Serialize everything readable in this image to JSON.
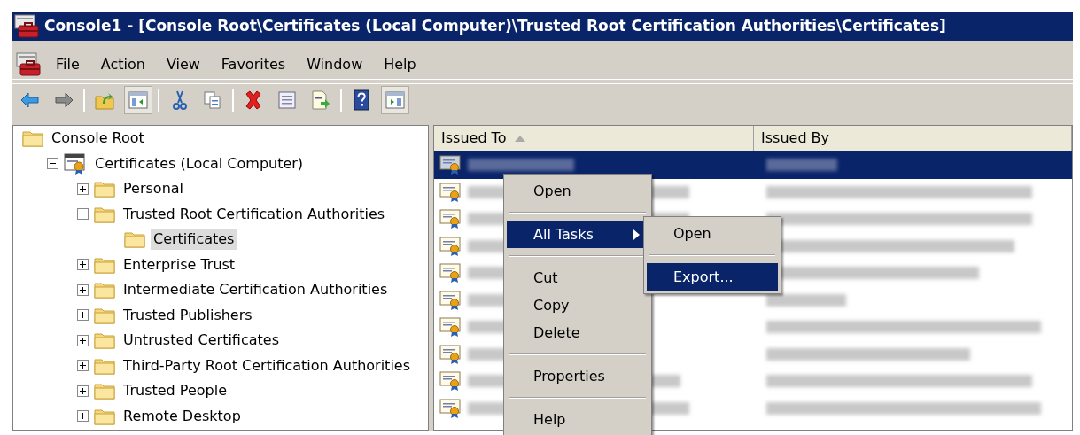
{
  "window": {
    "title": "Console1 - [Console Root\\Certificates (Local Computer)\\Trusted Root Certification Authorities\\Certificates]"
  },
  "menu_bar": [
    "File",
    "Action",
    "View",
    "Favorites",
    "Window",
    "Help"
  ],
  "toolbar": [
    {
      "kind": "back",
      "pressed": false
    },
    {
      "kind": "forward",
      "pressed": false
    },
    {
      "kind": "separator"
    },
    {
      "kind": "up",
      "pressed": false
    },
    {
      "kind": "tree",
      "pressed": true
    },
    {
      "kind": "separator"
    },
    {
      "kind": "cut",
      "pressed": false
    },
    {
      "kind": "copy",
      "pressed": false
    },
    {
      "kind": "separator"
    },
    {
      "kind": "delete",
      "pressed": false
    },
    {
      "kind": "properties",
      "pressed": false
    },
    {
      "kind": "export",
      "pressed": false
    },
    {
      "kind": "separator"
    },
    {
      "kind": "help",
      "pressed": false
    },
    {
      "kind": "action-pane",
      "pressed": true
    }
  ],
  "tree": [
    {
      "label": "Console Root",
      "kind": "folder",
      "selected": false,
      "children": [
        {
          "label": "Certificates (Local Computer)",
          "kind": "certstore",
          "expanded": true,
          "selected": false,
          "children": [
            {
              "label": "Personal",
              "kind": "folder",
              "expanded": false,
              "selected": false
            },
            {
              "label": "Trusted Root Certification Authorities",
              "kind": "folder",
              "expanded": true,
              "selected": false,
              "children": [
                {
                  "label": "Certificates",
                  "kind": "folder",
                  "selected": true
                }
              ]
            },
            {
              "label": "Enterprise Trust",
              "kind": "folder",
              "expanded": false,
              "selected": false
            },
            {
              "label": "Intermediate Certification Authorities",
              "kind": "folder",
              "expanded": false,
              "selected": false
            },
            {
              "label": "Trusted Publishers",
              "kind": "folder",
              "expanded": false,
              "selected": false
            },
            {
              "label": "Untrusted Certificates",
              "kind": "folder",
              "expanded": false,
              "selected": false
            },
            {
              "label": "Third-Party Root Certification Authorities",
              "kind": "folder",
              "expanded": false,
              "selected": false
            },
            {
              "label": "Trusted People",
              "kind": "folder",
              "expanded": false,
              "selected": false
            },
            {
              "label": "Remote Desktop",
              "kind": "folder",
              "expanded": false,
              "selected": false
            }
          ]
        }
      ]
    }
  ],
  "list": {
    "columns": [
      {
        "label": "Issued To",
        "sorted": true
      },
      {
        "label": "Issued By",
        "sorted": false
      }
    ],
    "rows": [
      {
        "selected": true
      },
      {
        "selected": false
      },
      {
        "selected": false
      },
      {
        "selected": false
      },
      {
        "selected": false
      },
      {
        "selected": false
      },
      {
        "selected": false
      },
      {
        "selected": false
      },
      {
        "selected": false
      },
      {
        "selected": false
      }
    ]
  },
  "context_menu": {
    "items": [
      {
        "kind": "item",
        "label": "Open",
        "selected": false
      },
      {
        "kind": "separator"
      },
      {
        "kind": "submenu",
        "label": "All Tasks",
        "selected": true
      },
      {
        "kind": "separator"
      },
      {
        "kind": "item",
        "label": "Cut",
        "selected": false
      },
      {
        "kind": "item",
        "label": "Copy",
        "selected": false
      },
      {
        "kind": "item",
        "label": "Delete",
        "selected": false
      },
      {
        "kind": "separator"
      },
      {
        "kind": "item",
        "label": "Properties",
        "selected": false
      },
      {
        "kind": "separator"
      },
      {
        "kind": "item",
        "label": "Help",
        "selected": false
      }
    ],
    "submenu": [
      {
        "kind": "item",
        "label": "Open",
        "selected": false
      },
      {
        "kind": "separator"
      },
      {
        "kind": "item",
        "label": "Export...",
        "selected": true
      }
    ]
  }
}
